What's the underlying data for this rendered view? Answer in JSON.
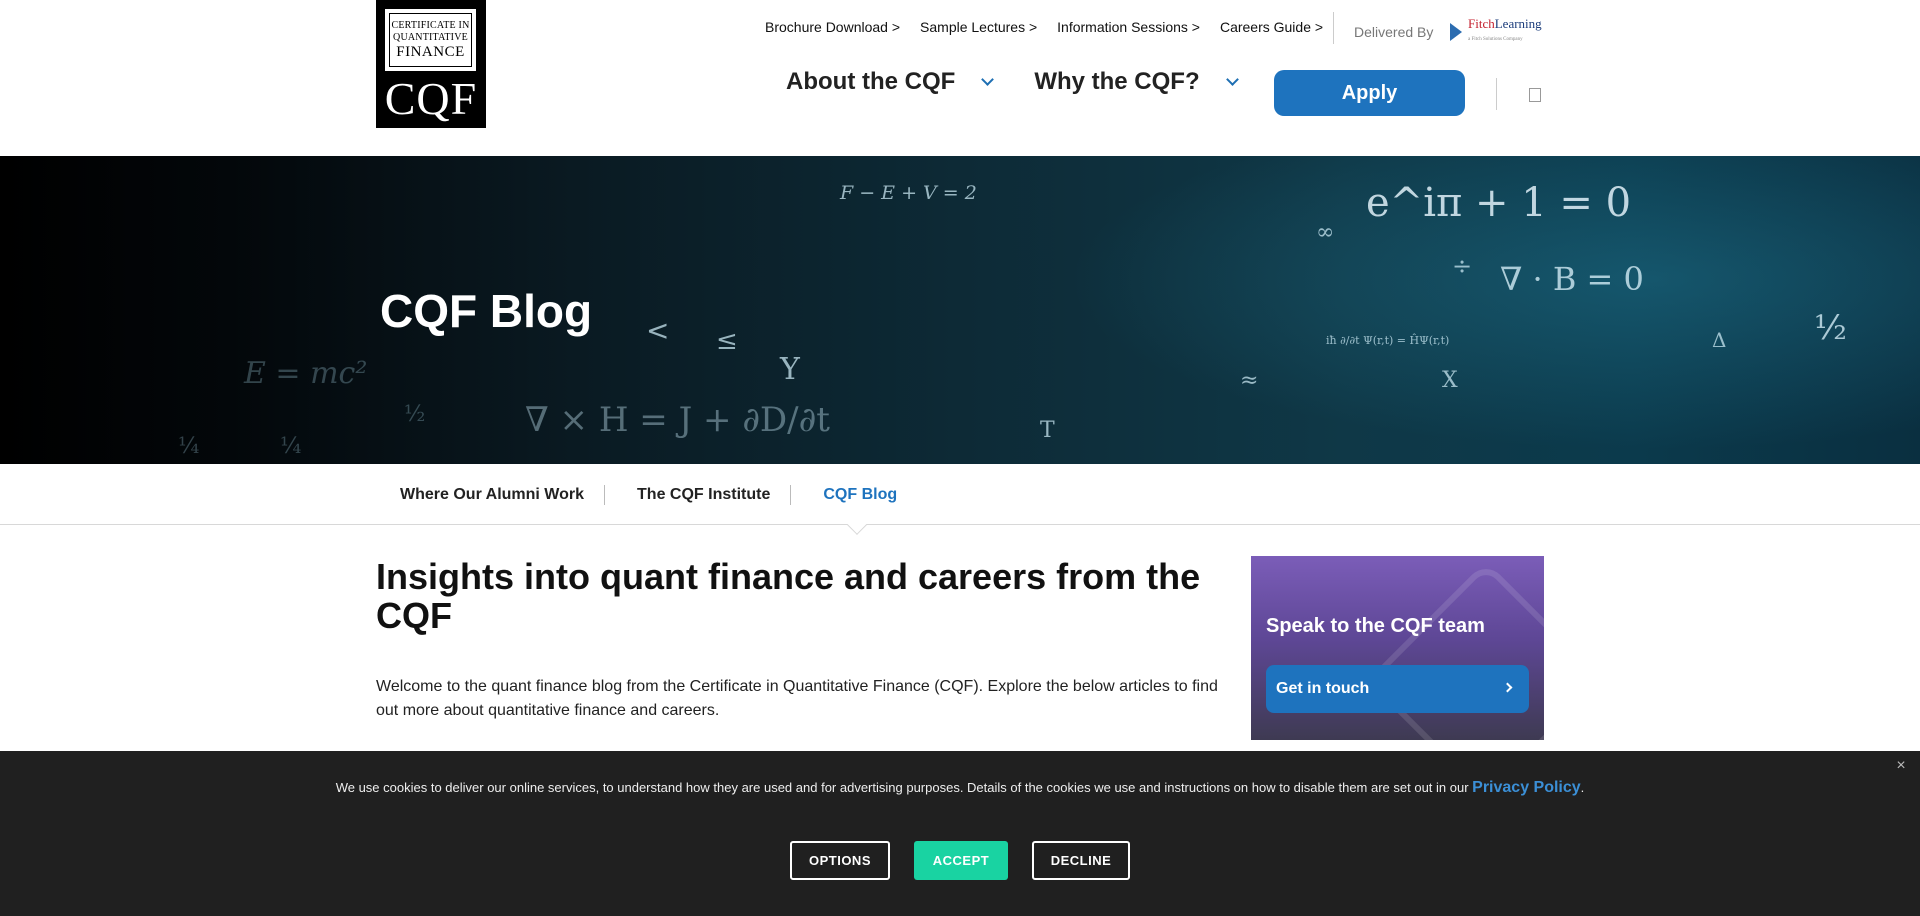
{
  "header": {
    "logo": {
      "line1": "CERTIFICATE IN",
      "line2": "QUANTITATIVE",
      "line3": "FINANCE",
      "mark": "CQF"
    },
    "top_links": [
      "Brochure Download >",
      "Sample Lectures >",
      "Information Sessions >",
      "Careers Guide >"
    ],
    "delivered_by": "Delivered By",
    "partner": {
      "name_a": "Fitch",
      "name_b": "Learning",
      "tagline": "a Fitch Solutions Company"
    },
    "nav": [
      {
        "label": "About the CQF"
      },
      {
        "label": "Why the CQF?"
      }
    ],
    "apply_label": "Apply"
  },
  "hero": {
    "title": "CQF Blog",
    "equations": [
      "F − E + V = 2",
      "e^iπ + 1 = 0",
      "∇ · B = 0",
      "½",
      "E = mc²",
      "∇ × H = J + ∂D/∂t",
      "½",
      "¼",
      "¼",
      "Δ",
      "≈",
      "<",
      "≤",
      "T",
      "Y",
      "X",
      "÷",
      "∞",
      "iħ ∂/∂t Ψ(r,t) = ĤΨ(r,t)"
    ]
  },
  "subnav": {
    "items": [
      {
        "label": "Where Our Alumni Work",
        "active": false
      },
      {
        "label": "The CQF Institute",
        "active": false
      },
      {
        "label": "CQF Blog",
        "active": true
      }
    ]
  },
  "content": {
    "title": "Insights into quant finance and careers from the CQF",
    "intro": "Welcome to the quant finance blog from the Certificate in Quantitative Finance (CQF). Explore the below articles to find out more about quantitative finance and careers."
  },
  "cta": {
    "title": "Speak to the CQF team",
    "button_label": "Get in touch"
  },
  "cookie": {
    "text": "We use cookies to deliver our online services, to understand how they are used and for advertising purposes. Details of the cookies we use and instructions on how to disable them are set out in our ",
    "link_label": "Privacy Policy",
    "suffix": ".",
    "close": "×",
    "options_label": "OPTIONS",
    "accept_label": "ACCEPT",
    "decline_label": "DECLINE"
  },
  "colors": {
    "brand_blue": "#1e73be",
    "accept_green": "#19d3a2",
    "cookie_bg": "#202020",
    "cta_purple": "#7b5db8"
  }
}
